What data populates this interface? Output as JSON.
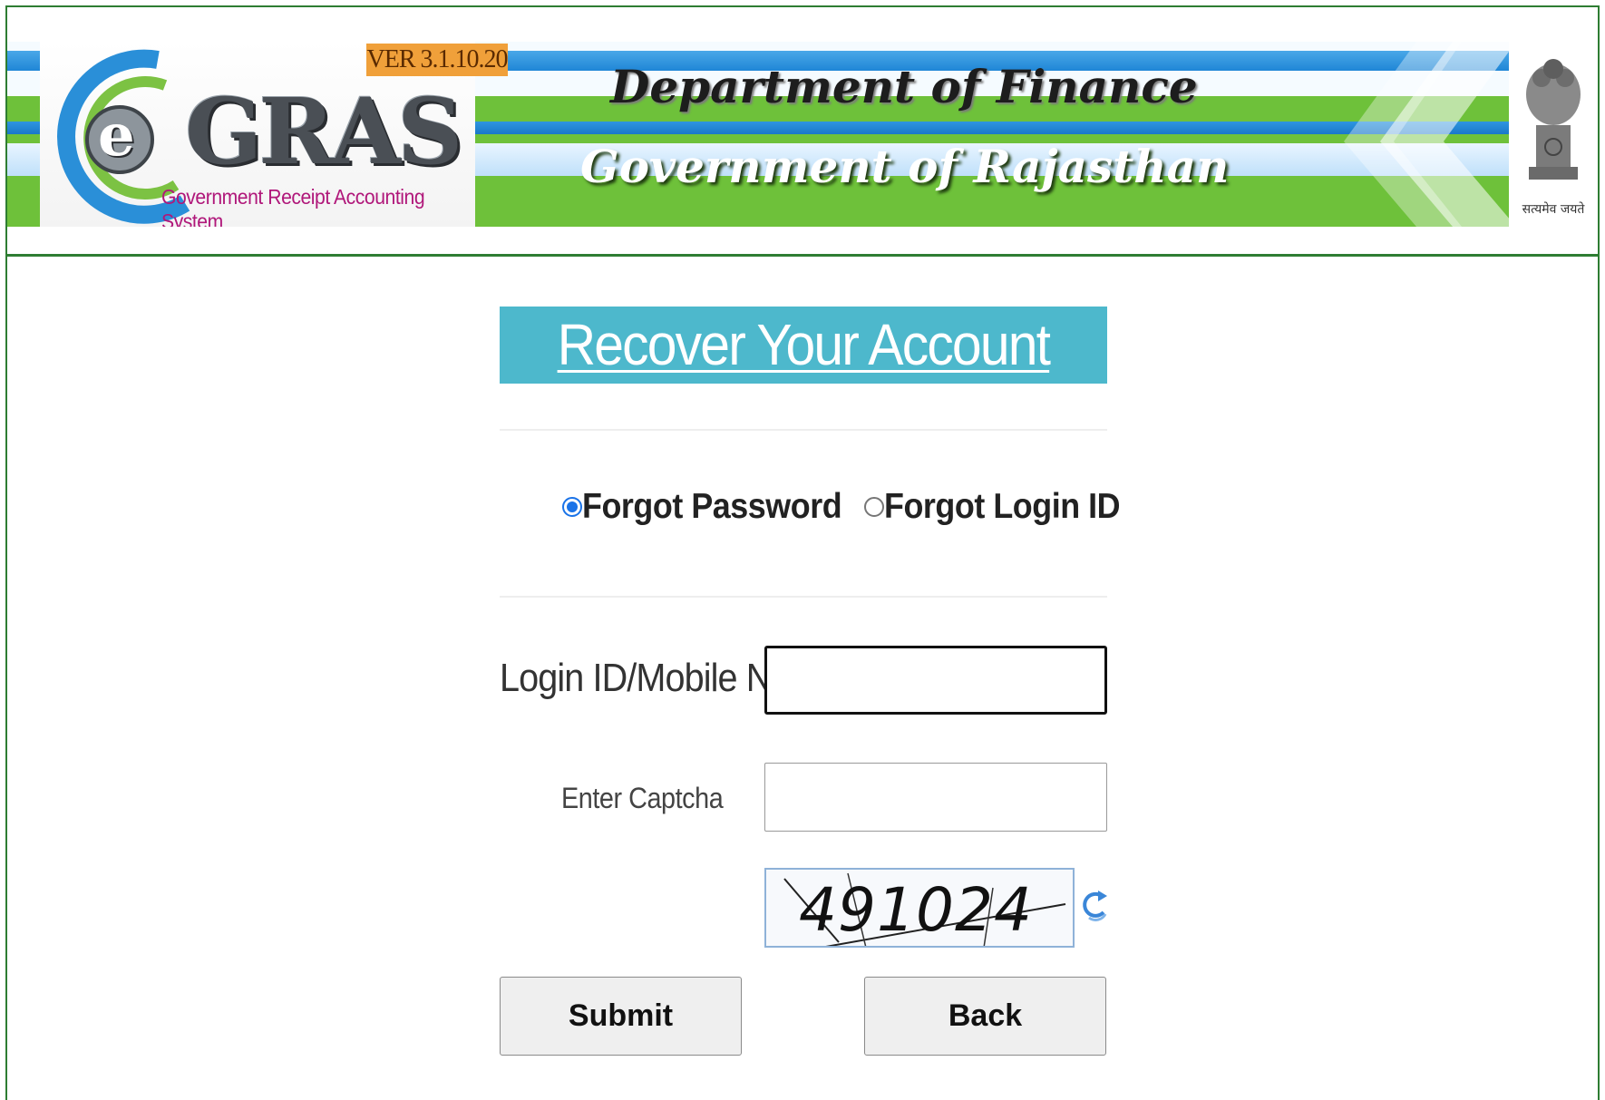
{
  "header": {
    "version": "VER 3.1.10.20",
    "logo_word": "GRAS",
    "logo_letter": "e",
    "logo_subtitle": "Government Receipt Accounting System",
    "department": "Department of Finance",
    "government": "Government of Rajasthan",
    "emblem_motto": "सत्यमेव जयते"
  },
  "form": {
    "title": "Recover Your Account",
    "options": [
      {
        "label": "Forgot Password",
        "selected": true
      },
      {
        "label": "Forgot Login ID",
        "selected": false
      }
    ],
    "login_label": "Login ID/Mobile No",
    "login_value": "",
    "captcha_label": "Enter Captcha",
    "captcha_value": "",
    "captcha_text": "491024",
    "submit_label": "Submit",
    "back_label": "Back"
  },
  "colors": {
    "accent_title_bar": "#4db8cc",
    "border_green": "#2e7d32",
    "banner_green": "#6ec13a",
    "radio_selected": "#1a73e8"
  }
}
